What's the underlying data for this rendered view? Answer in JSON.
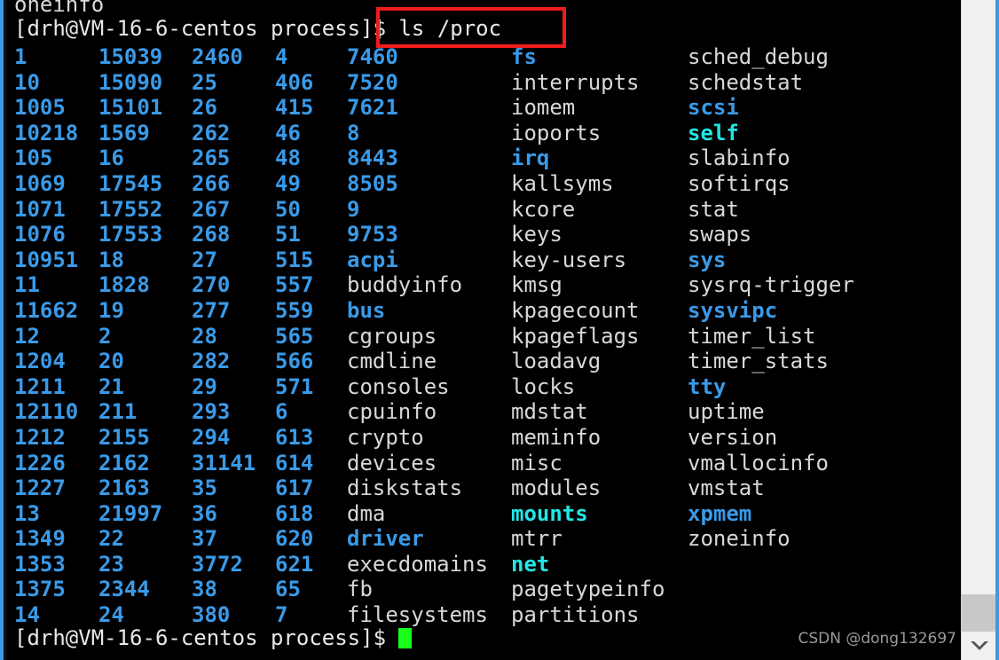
{
  "terminal": {
    "clipped_top_line": "oneinfo",
    "prompt": "[drh@VM-16-6-centos process]$ ",
    "command": "ls /proc",
    "prompt_bottom": "[drh@VM-16-6-centos process]$ ",
    "colors": {
      "background": "#000000",
      "file": "#d8d8d8",
      "directory": "#3a9ae8",
      "symlink": "#23e5e5",
      "cursor": "#1aff1a",
      "window_border": "#3d9ae0",
      "annotation_box": "#ef1c1c"
    },
    "rows": [
      [
        {
          "t": "1",
          "k": "dir"
        },
        {
          "t": "15039",
          "k": "dir"
        },
        {
          "t": "2460",
          "k": "dir"
        },
        {
          "t": "4",
          "k": "dir"
        },
        {
          "t": "7460",
          "k": "dir"
        },
        {
          "t": "fs",
          "k": "dir"
        },
        {
          "t": "sched_debug",
          "k": "file"
        }
      ],
      [
        {
          "t": "10",
          "k": "dir"
        },
        {
          "t": "15090",
          "k": "dir"
        },
        {
          "t": "25",
          "k": "dir"
        },
        {
          "t": "406",
          "k": "dir"
        },
        {
          "t": "7520",
          "k": "dir"
        },
        {
          "t": "interrupts",
          "k": "file"
        },
        {
          "t": "schedstat",
          "k": "file"
        }
      ],
      [
        {
          "t": "1005",
          "k": "dir"
        },
        {
          "t": "15101",
          "k": "dir"
        },
        {
          "t": "26",
          "k": "dir"
        },
        {
          "t": "415",
          "k": "dir"
        },
        {
          "t": "7621",
          "k": "dir"
        },
        {
          "t": "iomem",
          "k": "file"
        },
        {
          "t": "scsi",
          "k": "dir"
        }
      ],
      [
        {
          "t": "10218",
          "k": "dir"
        },
        {
          "t": "1569",
          "k": "dir"
        },
        {
          "t": "262",
          "k": "dir"
        },
        {
          "t": "46",
          "k": "dir"
        },
        {
          "t": "8",
          "k": "dir"
        },
        {
          "t": "ioports",
          "k": "file"
        },
        {
          "t": "self",
          "k": "link"
        }
      ],
      [
        {
          "t": "105",
          "k": "dir"
        },
        {
          "t": "16",
          "k": "dir"
        },
        {
          "t": "265",
          "k": "dir"
        },
        {
          "t": "48",
          "k": "dir"
        },
        {
          "t": "8443",
          "k": "dir"
        },
        {
          "t": "irq",
          "k": "dir"
        },
        {
          "t": "slabinfo",
          "k": "file"
        }
      ],
      [
        {
          "t": "1069",
          "k": "dir"
        },
        {
          "t": "17545",
          "k": "dir"
        },
        {
          "t": "266",
          "k": "dir"
        },
        {
          "t": "49",
          "k": "dir"
        },
        {
          "t": "8505",
          "k": "dir"
        },
        {
          "t": "kallsyms",
          "k": "file"
        },
        {
          "t": "softirqs",
          "k": "file"
        }
      ],
      [
        {
          "t": "1071",
          "k": "dir"
        },
        {
          "t": "17552",
          "k": "dir"
        },
        {
          "t": "267",
          "k": "dir"
        },
        {
          "t": "50",
          "k": "dir"
        },
        {
          "t": "9",
          "k": "dir"
        },
        {
          "t": "kcore",
          "k": "file"
        },
        {
          "t": "stat",
          "k": "file"
        }
      ],
      [
        {
          "t": "1076",
          "k": "dir"
        },
        {
          "t": "17553",
          "k": "dir"
        },
        {
          "t": "268",
          "k": "dir"
        },
        {
          "t": "51",
          "k": "dir"
        },
        {
          "t": "9753",
          "k": "dir"
        },
        {
          "t": "keys",
          "k": "file"
        },
        {
          "t": "swaps",
          "k": "file"
        }
      ],
      [
        {
          "t": "10951",
          "k": "dir"
        },
        {
          "t": "18",
          "k": "dir"
        },
        {
          "t": "27",
          "k": "dir"
        },
        {
          "t": "515",
          "k": "dir"
        },
        {
          "t": "acpi",
          "k": "dir"
        },
        {
          "t": "key-users",
          "k": "file"
        },
        {
          "t": "sys",
          "k": "dir"
        }
      ],
      [
        {
          "t": "11",
          "k": "dir"
        },
        {
          "t": "1828",
          "k": "dir"
        },
        {
          "t": "270",
          "k": "dir"
        },
        {
          "t": "557",
          "k": "dir"
        },
        {
          "t": "buddyinfo",
          "k": "file"
        },
        {
          "t": "kmsg",
          "k": "file"
        },
        {
          "t": "sysrq-trigger",
          "k": "file"
        }
      ],
      [
        {
          "t": "11662",
          "k": "dir"
        },
        {
          "t": "19",
          "k": "dir"
        },
        {
          "t": "277",
          "k": "dir"
        },
        {
          "t": "559",
          "k": "dir"
        },
        {
          "t": "bus",
          "k": "dir"
        },
        {
          "t": "kpagecount",
          "k": "file"
        },
        {
          "t": "sysvipc",
          "k": "dir"
        }
      ],
      [
        {
          "t": "12",
          "k": "dir"
        },
        {
          "t": "2",
          "k": "dir"
        },
        {
          "t": "28",
          "k": "dir"
        },
        {
          "t": "565",
          "k": "dir"
        },
        {
          "t": "cgroups",
          "k": "file"
        },
        {
          "t": "kpageflags",
          "k": "file"
        },
        {
          "t": "timer_list",
          "k": "file"
        }
      ],
      [
        {
          "t": "1204",
          "k": "dir"
        },
        {
          "t": "20",
          "k": "dir"
        },
        {
          "t": "282",
          "k": "dir"
        },
        {
          "t": "566",
          "k": "dir"
        },
        {
          "t": "cmdline",
          "k": "file"
        },
        {
          "t": "loadavg",
          "k": "file"
        },
        {
          "t": "timer_stats",
          "k": "file"
        }
      ],
      [
        {
          "t": "1211",
          "k": "dir"
        },
        {
          "t": "21",
          "k": "dir"
        },
        {
          "t": "29",
          "k": "dir"
        },
        {
          "t": "571",
          "k": "dir"
        },
        {
          "t": "consoles",
          "k": "file"
        },
        {
          "t": "locks",
          "k": "file"
        },
        {
          "t": "tty",
          "k": "dir"
        }
      ],
      [
        {
          "t": "12110",
          "k": "dir"
        },
        {
          "t": "211",
          "k": "dir"
        },
        {
          "t": "293",
          "k": "dir"
        },
        {
          "t": "6",
          "k": "dir"
        },
        {
          "t": "cpuinfo",
          "k": "file"
        },
        {
          "t": "mdstat",
          "k": "file"
        },
        {
          "t": "uptime",
          "k": "file"
        }
      ],
      [
        {
          "t": "1212",
          "k": "dir"
        },
        {
          "t": "2155",
          "k": "dir"
        },
        {
          "t": "294",
          "k": "dir"
        },
        {
          "t": "613",
          "k": "dir"
        },
        {
          "t": "crypto",
          "k": "file"
        },
        {
          "t": "meminfo",
          "k": "file"
        },
        {
          "t": "version",
          "k": "file"
        }
      ],
      [
        {
          "t": "1226",
          "k": "dir"
        },
        {
          "t": "2162",
          "k": "dir"
        },
        {
          "t": "31141",
          "k": "dir"
        },
        {
          "t": "614",
          "k": "dir"
        },
        {
          "t": "devices",
          "k": "file"
        },
        {
          "t": "misc",
          "k": "file"
        },
        {
          "t": "vmallocinfo",
          "k": "file"
        }
      ],
      [
        {
          "t": "1227",
          "k": "dir"
        },
        {
          "t": "2163",
          "k": "dir"
        },
        {
          "t": "35",
          "k": "dir"
        },
        {
          "t": "617",
          "k": "dir"
        },
        {
          "t": "diskstats",
          "k": "file"
        },
        {
          "t": "modules",
          "k": "file"
        },
        {
          "t": "vmstat",
          "k": "file"
        }
      ],
      [
        {
          "t": "13",
          "k": "dir"
        },
        {
          "t": "21997",
          "k": "dir"
        },
        {
          "t": "36",
          "k": "dir"
        },
        {
          "t": "618",
          "k": "dir"
        },
        {
          "t": "dma",
          "k": "file"
        },
        {
          "t": "mounts",
          "k": "link"
        },
        {
          "t": "xpmem",
          "k": "dir"
        }
      ],
      [
        {
          "t": "1349",
          "k": "dir"
        },
        {
          "t": "22",
          "k": "dir"
        },
        {
          "t": "37",
          "k": "dir"
        },
        {
          "t": "620",
          "k": "dir"
        },
        {
          "t": "driver",
          "k": "dir"
        },
        {
          "t": "mtrr",
          "k": "file"
        },
        {
          "t": "zoneinfo",
          "k": "file"
        }
      ],
      [
        {
          "t": "1353",
          "k": "dir"
        },
        {
          "t": "23",
          "k": "dir"
        },
        {
          "t": "3772",
          "k": "dir"
        },
        {
          "t": "621",
          "k": "dir"
        },
        {
          "t": "execdomains",
          "k": "file"
        },
        {
          "t": "net",
          "k": "link"
        },
        {
          "t": "",
          "k": "file"
        }
      ],
      [
        {
          "t": "1375",
          "k": "dir"
        },
        {
          "t": "2344",
          "k": "dir"
        },
        {
          "t": "38",
          "k": "dir"
        },
        {
          "t": "65",
          "k": "dir"
        },
        {
          "t": "fb",
          "k": "file"
        },
        {
          "t": "pagetypeinfo",
          "k": "file"
        },
        {
          "t": "",
          "k": "file"
        }
      ],
      [
        {
          "t": "14",
          "k": "dir"
        },
        {
          "t": "24",
          "k": "dir"
        },
        {
          "t": "380",
          "k": "dir"
        },
        {
          "t": "7",
          "k": "dir"
        },
        {
          "t": "filesystems",
          "k": "file"
        },
        {
          "t": "partitions",
          "k": "file"
        },
        {
          "t": "",
          "k": "file"
        }
      ]
    ]
  },
  "scrollbar": {
    "down_arrow_icon": "chevron-down-icon"
  },
  "watermark": {
    "text": "CSDN @dong132697"
  }
}
